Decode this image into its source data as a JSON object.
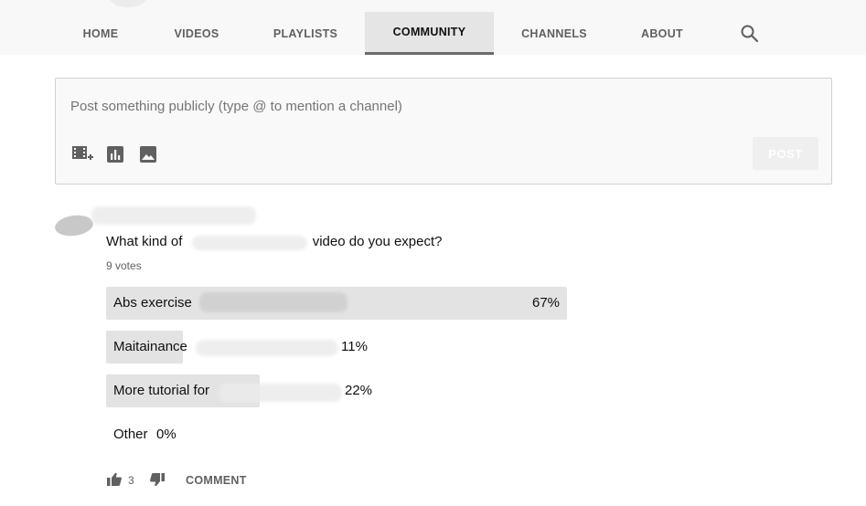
{
  "nav": {
    "tabs": [
      {
        "label": "HOME"
      },
      {
        "label": "VIDEOS"
      },
      {
        "label": "PLAYLISTS"
      },
      {
        "label": "COMMUNITY",
        "active": true
      },
      {
        "label": "CHANNELS"
      },
      {
        "label": "ABOUT"
      }
    ],
    "search_icon": "search-icon"
  },
  "composer": {
    "placeholder": "Post something publicly (type @ to mention a channel)",
    "tools": [
      "add-video-icon",
      "poll-icon",
      "image-icon"
    ],
    "post_label": "POST"
  },
  "post": {
    "question_start": "What kind of",
    "question_end": "video do you expect?",
    "votes": "9 votes",
    "options": [
      {
        "label": "Abs exercise",
        "percent": "67%",
        "value": 67
      },
      {
        "label": "Maitainance",
        "percent": "11%",
        "value": 11
      },
      {
        "label": "More tutorial for",
        "percent": "22%",
        "value": 22
      },
      {
        "label": "Other",
        "percent": "0%",
        "value": 0
      }
    ],
    "likes": "3",
    "comment_label": "COMMENT",
    "icons": [
      "thumb-up-icon",
      "thumb-down-icon"
    ]
  },
  "colors": {
    "active_tab_bg": "#e5e5e5",
    "poll_fill": "#e3e3e3",
    "secondary_text": "#606060"
  }
}
